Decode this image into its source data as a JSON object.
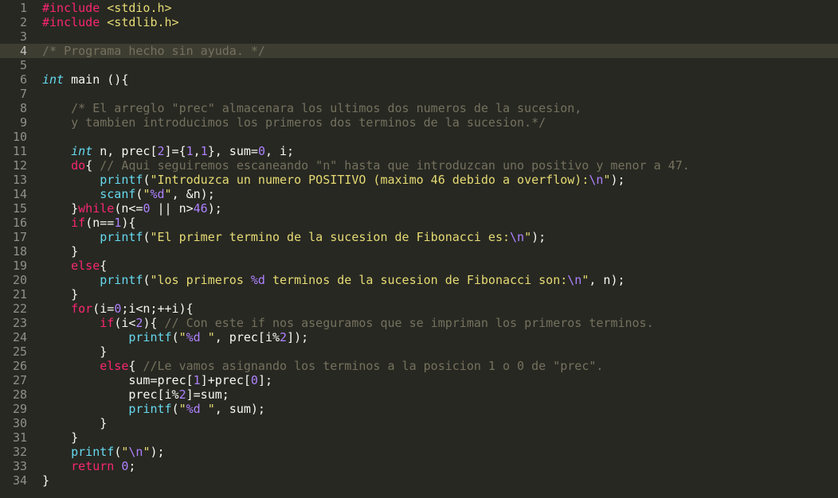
{
  "editor": {
    "active_line": 4,
    "colors": {
      "background": "#272822",
      "preprocessor": "#f92672",
      "string": "#e6db74",
      "comment": "#75715e",
      "keyword": "#f92672",
      "type": "#66d9ef",
      "function": "#66d9ef",
      "number": "#ae81ff"
    },
    "lines": [
      [
        [
          "pp",
          "#include "
        ],
        [
          "str",
          "<stdio.h>"
        ]
      ],
      [
        [
          "pp",
          "#include "
        ],
        [
          "str",
          "<stdlib.h>"
        ]
      ],
      [],
      [
        [
          "cm",
          "/* Programa hecho sin ayuda. */"
        ]
      ],
      [],
      [
        [
          "ty",
          "int"
        ],
        [
          "txt",
          " main (){"
        ]
      ],
      [],
      [
        [
          "cm",
          "    /* El arreglo \"prec\" almacenara los ultimos dos numeros de la sucesion,"
        ]
      ],
      [
        [
          "cm",
          "    y tambien introducimos los primeros dos terminos de la sucesion.*/"
        ]
      ],
      [],
      [
        [
          "txt",
          "    "
        ],
        [
          "ty",
          "int"
        ],
        [
          "txt",
          " n, prec["
        ],
        [
          "num",
          "2"
        ],
        [
          "txt",
          "]={"
        ],
        [
          "num",
          "1"
        ],
        [
          "txt",
          ","
        ],
        [
          "num",
          "1"
        ],
        [
          "txt",
          "}, sum="
        ],
        [
          "num",
          "0"
        ],
        [
          "txt",
          ", i;"
        ]
      ],
      [
        [
          "txt",
          "    "
        ],
        [
          "kw",
          "do"
        ],
        [
          "txt",
          "{ "
        ],
        [
          "cm",
          "// Aqui seguiremos escaneando \"n\" hasta que introduzcan uno positivo y menor a 47."
        ]
      ],
      [
        [
          "txt",
          "        "
        ],
        [
          "fn",
          "printf"
        ],
        [
          "txt",
          "("
        ],
        [
          "str",
          "\"Introduzca un numero POSITIVO (maximo 46 debido a overflow):"
        ],
        [
          "esc",
          "\\n"
        ],
        [
          "str",
          "\""
        ],
        [
          "txt",
          ");"
        ]
      ],
      [
        [
          "txt",
          "        "
        ],
        [
          "fn",
          "scanf"
        ],
        [
          "txt",
          "("
        ],
        [
          "str",
          "\""
        ],
        [
          "esc",
          "%d"
        ],
        [
          "str",
          "\""
        ],
        [
          "txt",
          ", &n);"
        ]
      ],
      [
        [
          "txt",
          "    }"
        ],
        [
          "kw",
          "while"
        ],
        [
          "txt",
          "(n<="
        ],
        [
          "num",
          "0"
        ],
        [
          "txt",
          " || n>"
        ],
        [
          "num",
          "46"
        ],
        [
          "txt",
          ");"
        ]
      ],
      [
        [
          "txt",
          "    "
        ],
        [
          "kw",
          "if"
        ],
        [
          "txt",
          "(n=="
        ],
        [
          "num",
          "1"
        ],
        [
          "txt",
          "){"
        ]
      ],
      [
        [
          "txt",
          "        "
        ],
        [
          "fn",
          "printf"
        ],
        [
          "txt",
          "("
        ],
        [
          "str",
          "\"El primer termino de la sucesion de Fibonacci es:"
        ],
        [
          "esc",
          "\\n"
        ],
        [
          "str",
          "\""
        ],
        [
          "txt",
          ");"
        ]
      ],
      [
        [
          "txt",
          "    }"
        ]
      ],
      [
        [
          "txt",
          "    "
        ],
        [
          "kw",
          "else"
        ],
        [
          "txt",
          "{"
        ]
      ],
      [
        [
          "txt",
          "        "
        ],
        [
          "fn",
          "printf"
        ],
        [
          "txt",
          "("
        ],
        [
          "str",
          "\"los primeros "
        ],
        [
          "esc",
          "%d"
        ],
        [
          "str",
          " terminos de la sucesion de Fibonacci son:"
        ],
        [
          "esc",
          "\\n"
        ],
        [
          "str",
          "\""
        ],
        [
          "txt",
          ", n);"
        ]
      ],
      [
        [
          "txt",
          "    }"
        ]
      ],
      [
        [
          "txt",
          "    "
        ],
        [
          "kw",
          "for"
        ],
        [
          "txt",
          "(i="
        ],
        [
          "num",
          "0"
        ],
        [
          "txt",
          ";i<n;++i){"
        ]
      ],
      [
        [
          "txt",
          "        "
        ],
        [
          "kw",
          "if"
        ],
        [
          "txt",
          "(i<"
        ],
        [
          "num",
          "2"
        ],
        [
          "txt",
          "){ "
        ],
        [
          "cm",
          "// Con este if nos aseguramos que se impriman los primeros terminos."
        ]
      ],
      [
        [
          "txt",
          "            "
        ],
        [
          "fn",
          "printf"
        ],
        [
          "txt",
          "("
        ],
        [
          "str",
          "\""
        ],
        [
          "esc",
          "%d"
        ],
        [
          "str",
          " \""
        ],
        [
          "txt",
          ", prec[i%"
        ],
        [
          "num",
          "2"
        ],
        [
          "txt",
          "]);"
        ]
      ],
      [
        [
          "txt",
          "        }"
        ]
      ],
      [
        [
          "txt",
          "        "
        ],
        [
          "kw",
          "else"
        ],
        [
          "txt",
          "{ "
        ],
        [
          "cm",
          "//Le vamos asignando los terminos a la posicion 1 o 0 de \"prec\"."
        ]
      ],
      [
        [
          "txt",
          "            sum=prec["
        ],
        [
          "num",
          "1"
        ],
        [
          "txt",
          "]+prec["
        ],
        [
          "num",
          "0"
        ],
        [
          "txt",
          "];"
        ]
      ],
      [
        [
          "txt",
          "            prec[i%"
        ],
        [
          "num",
          "2"
        ],
        [
          "txt",
          "]=sum;"
        ]
      ],
      [
        [
          "txt",
          "            "
        ],
        [
          "fn",
          "printf"
        ],
        [
          "txt",
          "("
        ],
        [
          "str",
          "\""
        ],
        [
          "esc",
          "%d"
        ],
        [
          "str",
          " \""
        ],
        [
          "txt",
          ", sum);"
        ]
      ],
      [
        [
          "txt",
          "        }"
        ]
      ],
      [
        [
          "txt",
          "    }"
        ]
      ],
      [
        [
          "txt",
          "    "
        ],
        [
          "fn",
          "printf"
        ],
        [
          "txt",
          "("
        ],
        [
          "str",
          "\""
        ],
        [
          "esc",
          "\\n"
        ],
        [
          "str",
          "\""
        ],
        [
          "txt",
          ");"
        ]
      ],
      [
        [
          "txt",
          "    "
        ],
        [
          "kw",
          "return"
        ],
        [
          "txt",
          " "
        ],
        [
          "num",
          "0"
        ],
        [
          "txt",
          ";"
        ]
      ],
      [
        [
          "txt",
          "}"
        ]
      ]
    ]
  }
}
